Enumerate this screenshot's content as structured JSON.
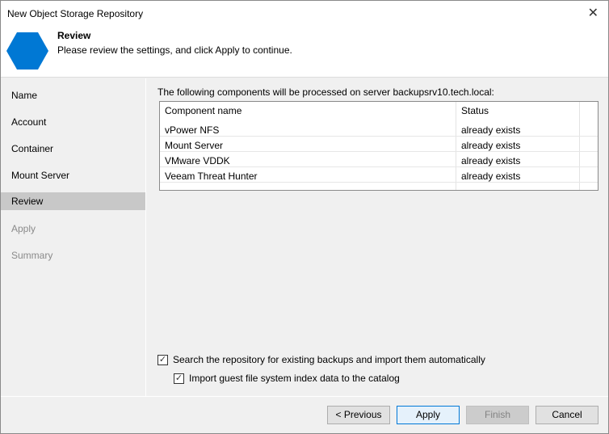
{
  "window": {
    "title": "New Object Storage Repository",
    "close": "✕"
  },
  "header": {
    "title": "Review",
    "subtitle": "Please review the settings, and click Apply to continue."
  },
  "steps": [
    {
      "label": "Name"
    },
    {
      "label": "Account"
    },
    {
      "label": "Container"
    },
    {
      "label": "Mount Server"
    },
    {
      "label": "Review"
    },
    {
      "label": "Apply"
    },
    {
      "label": "Summary"
    }
  ],
  "main": {
    "intro": "The following components will be processed on server backupsrv10.tech.local:",
    "columns": [
      "Component name",
      "Status"
    ],
    "rows": [
      [
        "vPower NFS",
        "already exists"
      ],
      [
        "Mount Server",
        "already exists"
      ],
      [
        "VMware VDDK",
        "already exists"
      ],
      [
        "Veeam Threat Hunter",
        "already exists"
      ]
    ],
    "options": [
      {
        "label": "Search the repository for existing backups and import them automatically",
        "checked": true
      },
      {
        "label": "Import guest file system index data to the catalog",
        "checked": true
      }
    ]
  },
  "buttons": {
    "previous": "< Previous",
    "apply": "Apply",
    "finish": "Finish",
    "cancel": "Cancel"
  },
  "colors": {
    "accent": "#0078d4"
  }
}
